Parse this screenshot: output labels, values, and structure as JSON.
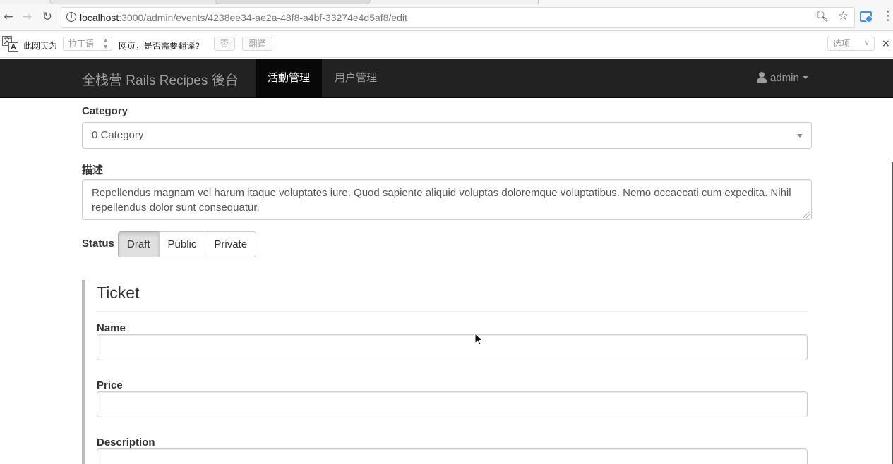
{
  "browser": {
    "url_host": "localhost",
    "url_path": ":3000/admin/events/4238ee34-ae2a-48f8-a4bf-33274e4d5af8/edit",
    "icons": [
      "back-icon",
      "forward-icon",
      "reload-icon",
      "info-icon",
      "zoom-icon",
      "star-icon",
      "extension-icon",
      "menu-icon"
    ]
  },
  "translate_bar": {
    "icon_glyph_a": "文",
    "icon_glyph_b": "A",
    "prefix": "此网页为",
    "language": "拉丁语",
    "suffix": "网页，是否需要翻译?",
    "no_label": "否",
    "translate_label": "翻译",
    "options_label": "选项",
    "close_glyph": "×"
  },
  "app_nav": {
    "brand": "全栈营 Rails Recipes 後台",
    "items": [
      {
        "label": "活動管理",
        "active": true
      },
      {
        "label": "用户管理",
        "active": false
      }
    ],
    "user": "admin"
  },
  "form": {
    "category": {
      "label": "Category",
      "value": "0 Category"
    },
    "description": {
      "label": "描述",
      "value": "Repellendus magnam vel harum itaque voluptates iure. Quod sapiente aliquid voluptas doloremque voluptatibus. Nemo occaecati cum expedita. Nihil repellendus dolor sunt consequatur."
    },
    "status": {
      "label": "Status",
      "options": [
        "Draft",
        "Public",
        "Private"
      ],
      "selected": "Draft"
    },
    "ticket": {
      "title": "Ticket",
      "name_label": "Name",
      "name_value": "",
      "price_label": "Price",
      "price_value": "",
      "description_label": "Description",
      "description_value": ""
    }
  },
  "colors": {
    "navbar_bg": "#222222",
    "navbar_active_bg": "#080808",
    "navbar_text": "#9d9d9d"
  }
}
